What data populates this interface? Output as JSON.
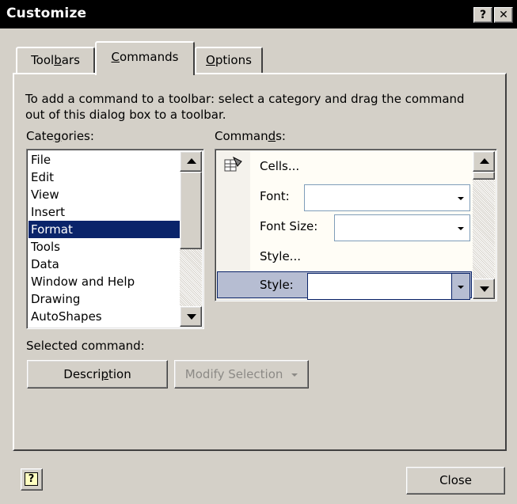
{
  "window": {
    "title": "Customize",
    "help_btn": "?",
    "close_btn": "✕"
  },
  "tabs": [
    {
      "label": "Toolbars",
      "selected": false
    },
    {
      "label": "Commands",
      "selected": true
    },
    {
      "label": "Options",
      "selected": false
    }
  ],
  "commands_tab": {
    "instruction": "To add a command to a toolbar: select a category and drag the command out of this dialog box to a toolbar.",
    "categories_label": "Categories:",
    "commands_label": "Commands:",
    "categories": [
      "File",
      "Edit",
      "View",
      "Insert",
      "Format",
      "Tools",
      "Data",
      "Window and Help",
      "Drawing",
      "AutoShapes"
    ],
    "selected_category": "Format",
    "commands": [
      {
        "label": "Cells...",
        "has_icon": true,
        "combo": false,
        "selected": false
      },
      {
        "label": "Font:",
        "has_icon": false,
        "combo": true,
        "selected": false
      },
      {
        "label": "Font Size:",
        "has_icon": false,
        "combo": true,
        "selected": false
      },
      {
        "label": "Style...",
        "has_icon": false,
        "combo": false,
        "selected": false
      },
      {
        "label": "Style:",
        "has_icon": false,
        "combo": true,
        "selected": true
      }
    ],
    "selected_command_label": "Selected command:",
    "description_btn": "Description",
    "modify_selection_btn": "Modify Selection"
  },
  "footer": {
    "help_icon_glyph": "?",
    "close_btn": "Close"
  },
  "colors": {
    "face": "#d4d0c8",
    "selection": "#0a246a",
    "cmd_selection": "#b6bdd2",
    "title_bar": "#000000"
  }
}
